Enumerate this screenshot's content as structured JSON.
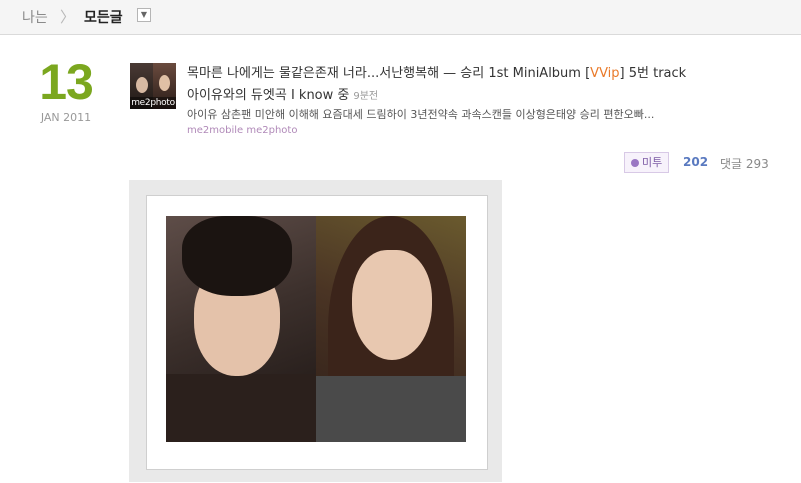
{
  "breadcrumb": {
    "root": "나는",
    "separator": "〉",
    "current": "모든글",
    "dropdown_icon": "chevron-down-icon"
  },
  "post": {
    "date": {
      "day": "13",
      "month_year": "JAN 2011"
    },
    "thumbnail_label": "me2photo",
    "title_before_accent": "목마른 나에게는 물같은존재 너라...서난행복해 — 승리 1st MiniAlbum [",
    "title_accent": "VVip",
    "title_after_accent": "] 5번 track",
    "title_line2": "아이유와의 듀엣곡 I know 중",
    "time_ago": "9분전",
    "tags": "아이유 삼촌팬 미안해 이해해 요즘대세 드림하이 3년전약속 과속스캔들 이상형은태양 승리 편한오빠...",
    "source": "me2mobile me2photo",
    "me2_label": "미투",
    "me2_count": "202",
    "comments_label": "댓글 293"
  },
  "colors": {
    "accent": "#e97a2a",
    "date_green": "#7ba71f",
    "me2_purple": "#7d5ba6",
    "count_blue": "#5a7ac0"
  }
}
